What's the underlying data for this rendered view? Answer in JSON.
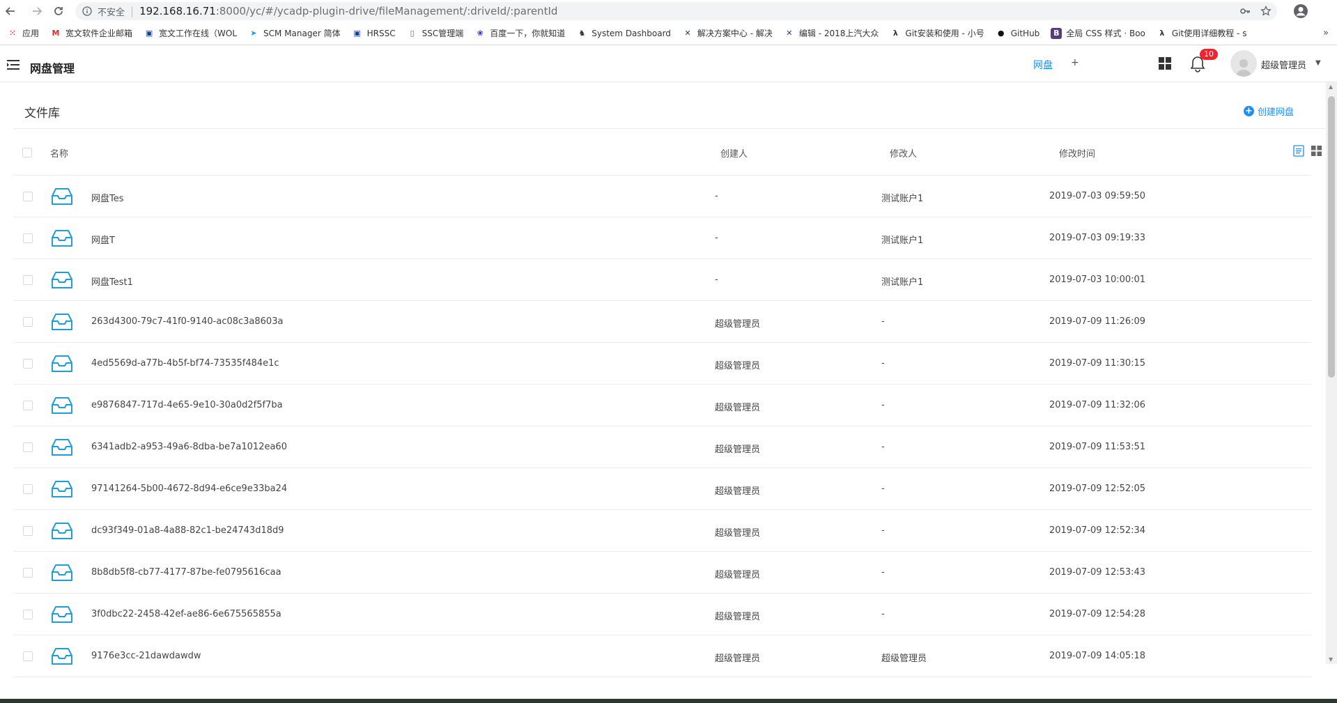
{
  "browser": {
    "security": "不安全",
    "url_host": "192.168.16.71",
    "url_path": ":8000/yc/#/ycadp-plugin-drive/fileManagement/:driveId/:parentId",
    "bookmarks": [
      {
        "label": "应用",
        "icon": "apps-grid-icon",
        "color": "#e53935"
      },
      {
        "label": "宽文软件企业邮箱",
        "icon": "mail-icon",
        "color": "#d93025"
      },
      {
        "label": "宽文工作在线（WOL",
        "icon": "bookmark-icon",
        "color": "#1a3e8c"
      },
      {
        "label": "SCM Manager 简体",
        "icon": "scm-icon",
        "color": "#2196f3"
      },
      {
        "label": "HRSSC",
        "icon": "bookmark-icon",
        "color": "#1a3e8c"
      },
      {
        "label": "SSC管理端",
        "icon": "page-icon",
        "color": "#666666"
      },
      {
        "label": "百度一下，你就知道",
        "icon": "baidu-icon",
        "color": "#2932e1"
      },
      {
        "label": "System Dashboard",
        "icon": "jenkins-icon",
        "color": "#333333"
      },
      {
        "label": "解决方案中心 - 解决",
        "icon": "x-icon",
        "color": "#1a3e8c"
      },
      {
        "label": "编辑 - 2018上汽大众",
        "icon": "x-icon",
        "color": "#1a3e8c"
      },
      {
        "label": "Git安装和使用 - 小号",
        "icon": "lambda-icon",
        "color": "#333333"
      },
      {
        "label": "GitHub",
        "icon": "github-icon",
        "color": "#111111"
      },
      {
        "label": "全局 CSS 样式 · Boo",
        "icon": "bootstrap-icon",
        "color": "#563d7c"
      },
      {
        "label": "Git使用详细教程 - s",
        "icon": "lambda-icon",
        "color": "#333333"
      }
    ],
    "more": "»"
  },
  "header": {
    "title": "网盘管理",
    "tab": "网盘",
    "add": "+",
    "notification_count": "10",
    "user_name": "超级管理员",
    "caret": "▼"
  },
  "content": {
    "section_title": "文件库",
    "create_label": "创建网盘",
    "columns": {
      "name": "名称",
      "creator": "创建人",
      "modifier": "修改人",
      "modified_time": "修改时间"
    },
    "rows": [
      {
        "name": "网盘Tes",
        "creator": "-",
        "modifier": "测试账户1",
        "time": "2019-07-03 09:59:50"
      },
      {
        "name": "网盘T",
        "creator": "-",
        "modifier": "测试账户1",
        "time": "2019-07-03 09:19:33"
      },
      {
        "name": "网盘Test1",
        "creator": "-",
        "modifier": "测试账户1",
        "time": "2019-07-03 10:00:01"
      },
      {
        "name": "263d4300-79c7-41f0-9140-ac08c3a8603a",
        "creator": "超级管理员",
        "modifier": "-",
        "time": "2019-07-09 11:26:09"
      },
      {
        "name": "4ed5569d-a77b-4b5f-bf74-73535f484e1c",
        "creator": "超级管理员",
        "modifier": "-",
        "time": "2019-07-09 11:30:15"
      },
      {
        "name": "e9876847-717d-4e65-9e10-30a0d2f5f7ba",
        "creator": "超级管理员",
        "modifier": "-",
        "time": "2019-07-09 11:32:06"
      },
      {
        "name": "6341adb2-a953-49a6-8dba-be7a1012ea60",
        "creator": "超级管理员",
        "modifier": "-",
        "time": "2019-07-09 11:53:51"
      },
      {
        "name": "97141264-5b00-4672-8d94-e6ce9e33ba24",
        "creator": "超级管理员",
        "modifier": "-",
        "time": "2019-07-09 12:52:05"
      },
      {
        "name": "dc93f349-01a8-4a88-82c1-be24743d18d9",
        "creator": "超级管理员",
        "modifier": "-",
        "time": "2019-07-09 12:52:34"
      },
      {
        "name": "8b8db5f8-cb77-4177-87be-fe0795616caa",
        "creator": "超级管理员",
        "modifier": "-",
        "time": "2019-07-09 12:53:43"
      },
      {
        "name": "3f0dbc22-2458-42ef-ae86-6e675565855a",
        "creator": "超级管理员",
        "modifier": "-",
        "time": "2019-07-09 12:54:28"
      },
      {
        "name": "9176e3cc-21dawdawdw",
        "creator": "超级管理员",
        "modifier": "超级管理员",
        "time": "2019-07-09 14:05:18"
      }
    ]
  },
  "colors": {
    "accent": "#1890ff",
    "drive_icon": "#1e9ed8",
    "badge": "#f5222d"
  }
}
